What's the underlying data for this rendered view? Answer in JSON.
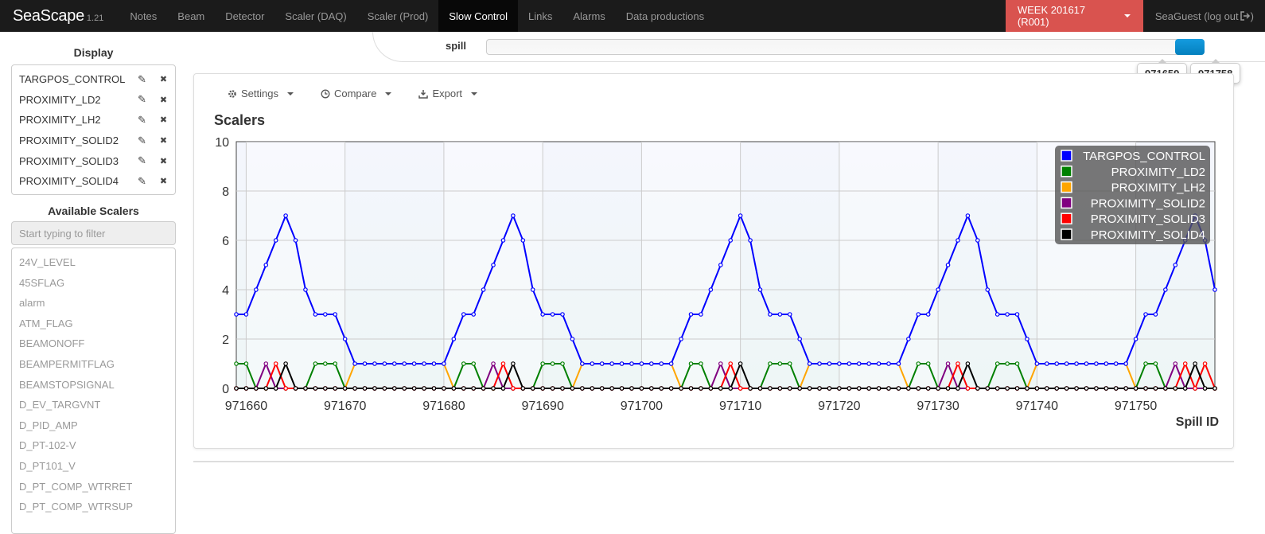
{
  "navbar": {
    "brand": "SeaScape",
    "version": "1.21",
    "items": [
      {
        "label": "Notes",
        "active": false
      },
      {
        "label": "Beam",
        "active": false
      },
      {
        "label": "Detector",
        "active": false
      },
      {
        "label": "Scaler (DAQ)",
        "active": false
      },
      {
        "label": "Scaler (Prod)",
        "active": false
      },
      {
        "label": "Slow Control",
        "active": true
      },
      {
        "label": "Links",
        "active": false
      },
      {
        "label": "Alarms",
        "active": false
      },
      {
        "label": "Data productions",
        "active": false
      }
    ],
    "week_label": "WEEK 201617 (R001)",
    "user_label": "SeaGuest (log out",
    "logout_icon": "sign-out-icon"
  },
  "sidebar": {
    "display_heading": "Display",
    "display_items": [
      "TARGPOS_CONTROL",
      "PROXIMITY_LD2",
      "PROXIMITY_LH2",
      "PROXIMITY_SOLID2",
      "PROXIMITY_SOLID3",
      "PROXIMITY_SOLID4"
    ],
    "edit_icon": "pencil-icon",
    "remove_icon": "close-icon",
    "available_heading": "Available Scalers",
    "filter_placeholder": "Start typing to filter",
    "available_items": [
      "24V_LEVEL",
      "45SFLAG",
      "alarm",
      "ATM_FLAG",
      "BEAMONOFF",
      "BEAMPERMITFLAG",
      "BEAMSTOPSIGNAL",
      "D_EV_TARGVNT",
      "D_PID_AMP",
      "D_PT-102-V",
      "D_PT101_V",
      "D_PT_COMP_WTRRET",
      "D_PT_COMP_WTRSUP"
    ]
  },
  "spill": {
    "label": "spill",
    "min_value": "971659",
    "max_value": "971758",
    "range_start_fraction": 0.96,
    "range_end_fraction": 1.0
  },
  "toolbar": {
    "settings_label": "Settings",
    "settings_icon": "gear-icon",
    "compare_label": "Compare",
    "compare_icon": "clock-icon",
    "export_label": "Export",
    "export_icon": "download-icon"
  },
  "chart_data": {
    "type": "line",
    "title": "Scalers",
    "xlabel": "Spill ID",
    "ylabel": "",
    "xlim": [
      971659,
      971758
    ],
    "ylim": [
      0,
      10
    ],
    "xticks": [
      971660,
      971670,
      971680,
      971690,
      971700,
      971710,
      971720,
      971730,
      971740,
      971750
    ],
    "yticks": [
      0,
      2,
      4,
      6,
      8,
      10
    ],
    "grid": true,
    "legend_position": "top-right",
    "x": [
      971659,
      971660,
      971661,
      971662,
      971663,
      971664,
      971665,
      971666,
      971667,
      971668,
      971669,
      971670,
      971671,
      971672,
      971673,
      971674,
      971675,
      971676,
      971677,
      971678,
      971679,
      971680,
      971681,
      971682,
      971683,
      971684,
      971685,
      971686,
      971687,
      971688,
      971689,
      971690,
      971691,
      971692,
      971693,
      971694,
      971695,
      971696,
      971697,
      971698,
      971699,
      971700,
      971701,
      971702,
      971703,
      971704,
      971705,
      971706,
      971707,
      971708,
      971709,
      971710,
      971711,
      971712,
      971713,
      971714,
      971715,
      971716,
      971717,
      971718,
      971719,
      971720,
      971721,
      971722,
      971723,
      971724,
      971725,
      971726,
      971727,
      971728,
      971729,
      971730,
      971731,
      971732,
      971733,
      971734,
      971735,
      971736,
      971737,
      971738,
      971739,
      971740,
      971741,
      971742,
      971743,
      971744,
      971745,
      971746,
      971747,
      971748,
      971749,
      971750,
      971751,
      971752,
      971753,
      971754,
      971755,
      971756,
      971757,
      971758
    ],
    "series": [
      {
        "name": "TARGPOS_CONTROL",
        "color": "#0000ff",
        "values": [
          3,
          3,
          4,
          5,
          6,
          7,
          6,
          4,
          3,
          3,
          3,
          2,
          1,
          1,
          1,
          1,
          1,
          1,
          1,
          1,
          1,
          1,
          2,
          3,
          3,
          4,
          5,
          6,
          7,
          6,
          4,
          3,
          3,
          3,
          2,
          1,
          1,
          1,
          1,
          1,
          1,
          1,
          1,
          1,
          1,
          2,
          3,
          3,
          4,
          5,
          6,
          7,
          6,
          4,
          3,
          3,
          3,
          2,
          1,
          1,
          1,
          1,
          1,
          1,
          1,
          1,
          1,
          1,
          2,
          3,
          3,
          4,
          5,
          6,
          7,
          6,
          4,
          3,
          3,
          3,
          2,
          1,
          1,
          1,
          1,
          1,
          1,
          1,
          1,
          1,
          1,
          2,
          3,
          3,
          4,
          5,
          6,
          7,
          6,
          4
        ]
      },
      {
        "name": "PROXIMITY_LD2",
        "color": "#008000",
        "values": [
          1,
          1,
          0,
          0,
          0,
          0,
          0,
          0,
          1,
          1,
          1,
          0,
          0,
          0,
          0,
          0,
          0,
          0,
          0,
          0,
          0,
          0,
          0,
          1,
          1,
          0,
          0,
          0,
          0,
          0,
          0,
          1,
          1,
          1,
          0,
          0,
          0,
          0,
          0,
          0,
          0,
          0,
          0,
          0,
          0,
          0,
          1,
          1,
          0,
          0,
          0,
          0,
          0,
          0,
          1,
          1,
          1,
          0,
          0,
          0,
          0,
          0,
          0,
          0,
          0,
          0,
          0,
          0,
          0,
          1,
          1,
          0,
          0,
          0,
          0,
          0,
          0,
          1,
          1,
          1,
          0,
          0,
          0,
          0,
          0,
          0,
          0,
          0,
          0,
          0,
          0,
          0,
          1,
          1,
          0,
          0,
          0,
          0,
          0,
          0
        ]
      },
      {
        "name": "PROXIMITY_LH2",
        "color": "#ffa500",
        "values": [
          0,
          0,
          0,
          0,
          0,
          0,
          0,
          0,
          0,
          0,
          0,
          0,
          1,
          1,
          1,
          1,
          1,
          1,
          1,
          1,
          1,
          1,
          0,
          0,
          0,
          0,
          0,
          0,
          0,
          0,
          0,
          0,
          0,
          0,
          0,
          1,
          1,
          1,
          1,
          1,
          1,
          1,
          1,
          1,
          1,
          0,
          0,
          0,
          0,
          0,
          0,
          0,
          0,
          0,
          0,
          0,
          0,
          0,
          1,
          1,
          1,
          1,
          1,
          1,
          1,
          1,
          1,
          1,
          0,
          0,
          0,
          0,
          0,
          0,
          0,
          0,
          0,
          0,
          0,
          0,
          0,
          1,
          1,
          1,
          1,
          1,
          1,
          1,
          1,
          1,
          1,
          0,
          0,
          0,
          0,
          0,
          0,
          0,
          0,
          0
        ]
      },
      {
        "name": "PROXIMITY_SOLID2",
        "color": "#800080",
        "values": [
          0,
          0,
          0,
          1,
          0,
          0,
          0,
          0,
          0,
          0,
          0,
          0,
          0,
          0,
          0,
          0,
          0,
          0,
          0,
          0,
          0,
          0,
          0,
          0,
          0,
          0,
          1,
          0,
          0,
          0,
          0,
          0,
          0,
          0,
          0,
          0,
          0,
          0,
          0,
          0,
          0,
          0,
          0,
          0,
          0,
          0,
          0,
          0,
          0,
          1,
          0,
          0,
          0,
          0,
          0,
          0,
          0,
          0,
          0,
          0,
          0,
          0,
          0,
          0,
          0,
          0,
          0,
          0,
          0,
          0,
          0,
          0,
          1,
          0,
          0,
          0,
          0,
          0,
          0,
          0,
          0,
          0,
          0,
          0,
          0,
          0,
          0,
          0,
          0,
          0,
          0,
          0,
          0,
          0,
          0,
          1,
          0,
          0,
          0,
          0
        ]
      },
      {
        "name": "PROXIMITY_SOLID3",
        "color": "#ff0000",
        "values": [
          0,
          0,
          0,
          0,
          1,
          0,
          0,
          0,
          0,
          0,
          0,
          0,
          0,
          0,
          0,
          0,
          0,
          0,
          0,
          0,
          0,
          0,
          0,
          0,
          0,
          0,
          0,
          1,
          0,
          0,
          0,
          0,
          0,
          0,
          0,
          0,
          0,
          0,
          0,
          0,
          0,
          0,
          0,
          0,
          0,
          0,
          0,
          0,
          0,
          0,
          1,
          0,
          0,
          0,
          0,
          0,
          0,
          0,
          0,
          0,
          0,
          0,
          0,
          0,
          0,
          0,
          0,
          0,
          0,
          0,
          0,
          0,
          0,
          1,
          0,
          0,
          0,
          0,
          0,
          0,
          0,
          0,
          0,
          0,
          0,
          0,
          0,
          0,
          0,
          0,
          0,
          0,
          0,
          0,
          0,
          0,
          1,
          0,
          1,
          0
        ]
      },
      {
        "name": "PROXIMITY_SOLID4",
        "color": "#000000",
        "values": [
          0,
          0,
          0,
          0,
          0,
          1,
          0,
          0,
          0,
          0,
          0,
          0,
          0,
          0,
          0,
          0,
          0,
          0,
          0,
          0,
          0,
          0,
          0,
          0,
          0,
          0,
          0,
          0,
          1,
          0,
          0,
          0,
          0,
          0,
          0,
          0,
          0,
          0,
          0,
          0,
          0,
          0,
          0,
          0,
          0,
          0,
          0,
          0,
          0,
          0,
          0,
          1,
          0,
          0,
          0,
          0,
          0,
          0,
          0,
          0,
          0,
          0,
          0,
          0,
          0,
          0,
          0,
          0,
          0,
          0,
          0,
          0,
          0,
          0,
          1,
          0,
          0,
          0,
          0,
          0,
          0,
          0,
          0,
          0,
          0,
          0,
          0,
          0,
          0,
          0,
          0,
          0,
          0,
          0,
          0,
          0,
          0,
          1,
          0,
          0
        ]
      }
    ]
  }
}
